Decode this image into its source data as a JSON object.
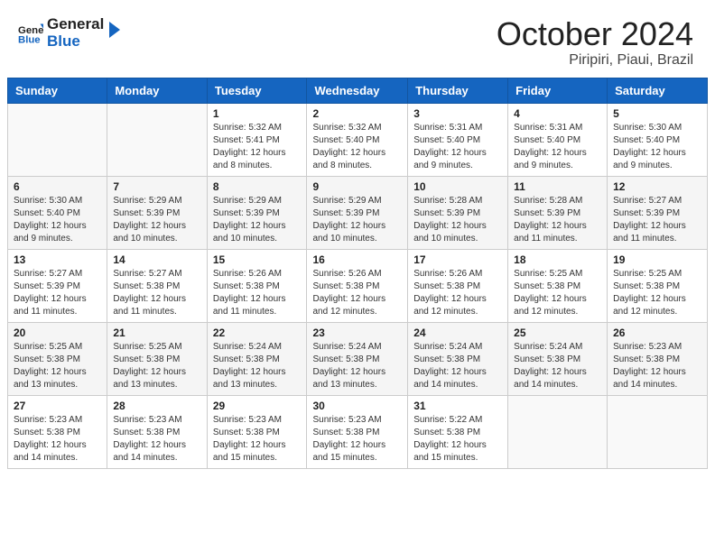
{
  "header": {
    "logo_general": "General",
    "logo_blue": "Blue",
    "month_title": "October 2024",
    "subtitle": "Piripiri, Piaui, Brazil"
  },
  "weekdays": [
    "Sunday",
    "Monday",
    "Tuesday",
    "Wednesday",
    "Thursday",
    "Friday",
    "Saturday"
  ],
  "weeks": [
    [
      {
        "day": "",
        "info": ""
      },
      {
        "day": "",
        "info": ""
      },
      {
        "day": "1",
        "info": "Sunrise: 5:32 AM\nSunset: 5:41 PM\nDaylight: 12 hours and 8 minutes."
      },
      {
        "day": "2",
        "info": "Sunrise: 5:32 AM\nSunset: 5:40 PM\nDaylight: 12 hours and 8 minutes."
      },
      {
        "day": "3",
        "info": "Sunrise: 5:31 AM\nSunset: 5:40 PM\nDaylight: 12 hours and 9 minutes."
      },
      {
        "day": "4",
        "info": "Sunrise: 5:31 AM\nSunset: 5:40 PM\nDaylight: 12 hours and 9 minutes."
      },
      {
        "day": "5",
        "info": "Sunrise: 5:30 AM\nSunset: 5:40 PM\nDaylight: 12 hours and 9 minutes."
      }
    ],
    [
      {
        "day": "6",
        "info": "Sunrise: 5:30 AM\nSunset: 5:40 PM\nDaylight: 12 hours and 9 minutes."
      },
      {
        "day": "7",
        "info": "Sunrise: 5:29 AM\nSunset: 5:39 PM\nDaylight: 12 hours and 10 minutes."
      },
      {
        "day": "8",
        "info": "Sunrise: 5:29 AM\nSunset: 5:39 PM\nDaylight: 12 hours and 10 minutes."
      },
      {
        "day": "9",
        "info": "Sunrise: 5:29 AM\nSunset: 5:39 PM\nDaylight: 12 hours and 10 minutes."
      },
      {
        "day": "10",
        "info": "Sunrise: 5:28 AM\nSunset: 5:39 PM\nDaylight: 12 hours and 10 minutes."
      },
      {
        "day": "11",
        "info": "Sunrise: 5:28 AM\nSunset: 5:39 PM\nDaylight: 12 hours and 11 minutes."
      },
      {
        "day": "12",
        "info": "Sunrise: 5:27 AM\nSunset: 5:39 PM\nDaylight: 12 hours and 11 minutes."
      }
    ],
    [
      {
        "day": "13",
        "info": "Sunrise: 5:27 AM\nSunset: 5:39 PM\nDaylight: 12 hours and 11 minutes."
      },
      {
        "day": "14",
        "info": "Sunrise: 5:27 AM\nSunset: 5:38 PM\nDaylight: 12 hours and 11 minutes."
      },
      {
        "day": "15",
        "info": "Sunrise: 5:26 AM\nSunset: 5:38 PM\nDaylight: 12 hours and 11 minutes."
      },
      {
        "day": "16",
        "info": "Sunrise: 5:26 AM\nSunset: 5:38 PM\nDaylight: 12 hours and 12 minutes."
      },
      {
        "day": "17",
        "info": "Sunrise: 5:26 AM\nSunset: 5:38 PM\nDaylight: 12 hours and 12 minutes."
      },
      {
        "day": "18",
        "info": "Sunrise: 5:25 AM\nSunset: 5:38 PM\nDaylight: 12 hours and 12 minutes."
      },
      {
        "day": "19",
        "info": "Sunrise: 5:25 AM\nSunset: 5:38 PM\nDaylight: 12 hours and 12 minutes."
      }
    ],
    [
      {
        "day": "20",
        "info": "Sunrise: 5:25 AM\nSunset: 5:38 PM\nDaylight: 12 hours and 13 minutes."
      },
      {
        "day": "21",
        "info": "Sunrise: 5:25 AM\nSunset: 5:38 PM\nDaylight: 12 hours and 13 minutes."
      },
      {
        "day": "22",
        "info": "Sunrise: 5:24 AM\nSunset: 5:38 PM\nDaylight: 12 hours and 13 minutes."
      },
      {
        "day": "23",
        "info": "Sunrise: 5:24 AM\nSunset: 5:38 PM\nDaylight: 12 hours and 13 minutes."
      },
      {
        "day": "24",
        "info": "Sunrise: 5:24 AM\nSunset: 5:38 PM\nDaylight: 12 hours and 14 minutes."
      },
      {
        "day": "25",
        "info": "Sunrise: 5:24 AM\nSunset: 5:38 PM\nDaylight: 12 hours and 14 minutes."
      },
      {
        "day": "26",
        "info": "Sunrise: 5:23 AM\nSunset: 5:38 PM\nDaylight: 12 hours and 14 minutes."
      }
    ],
    [
      {
        "day": "27",
        "info": "Sunrise: 5:23 AM\nSunset: 5:38 PM\nDaylight: 12 hours and 14 minutes."
      },
      {
        "day": "28",
        "info": "Sunrise: 5:23 AM\nSunset: 5:38 PM\nDaylight: 12 hours and 14 minutes."
      },
      {
        "day": "29",
        "info": "Sunrise: 5:23 AM\nSunset: 5:38 PM\nDaylight: 12 hours and 15 minutes."
      },
      {
        "day": "30",
        "info": "Sunrise: 5:23 AM\nSunset: 5:38 PM\nDaylight: 12 hours and 15 minutes."
      },
      {
        "day": "31",
        "info": "Sunrise: 5:22 AM\nSunset: 5:38 PM\nDaylight: 12 hours and 15 minutes."
      },
      {
        "day": "",
        "info": ""
      },
      {
        "day": "",
        "info": ""
      }
    ]
  ]
}
